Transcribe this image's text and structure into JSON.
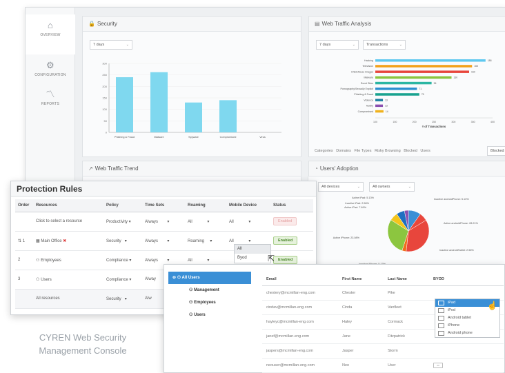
{
  "nav": [
    {
      "label": "OVERVIEW",
      "icon": "home-icon"
    },
    {
      "label": "CONFIGURATION",
      "icon": "gear-icon"
    },
    {
      "label": "REPORTS",
      "icon": "chart-icon"
    }
  ],
  "security": {
    "title": "Security",
    "range": "7 days",
    "chart_data": {
      "type": "bar",
      "categories": [
        "Phishing & Fraud",
        "Malware",
        "Spyware",
        "Compromised",
        "Virus"
      ],
      "values": [
        240,
        262,
        130,
        140,
        0
      ],
      "ylim": [
        0,
        300
      ],
      "yticks": [
        "300",
        "250",
        "200",
        "150",
        "100",
        "50",
        "0"
      ]
    }
  },
  "traffic": {
    "title": "Web Traffic Analysis",
    "range": "7 days",
    "metric": "Transactions",
    "xlabel": "# of Transactions",
    "tabs": [
      "Categories",
      "Domains",
      "File Types",
      "Risky Browsing",
      "Blocked",
      "Users"
    ],
    "blocked_btn": "Blocked",
    "chart_data": {
      "type": "bar",
      "categories": [
        "Hacking",
        "Television",
        "Child Abuse Images",
        "Malware",
        "Event Sites",
        "Pornography/Sexually Explicit",
        "Phishing & Fraud",
        "Violence",
        "Nudity",
        "Compromised"
      ],
      "values": [
        188,
        165,
        160,
        130,
        96,
        71,
        75,
        13,
        13,
        14
      ],
      "colors": [
        "#5ec8ef",
        "#f3a21c",
        "#e8463c",
        "#8cc63f",
        "#2bb6a3",
        "#2c8fd0",
        "#18a28f",
        "#1b7ea1",
        "#8a4fb0",
        "#f0b21c"
      ],
      "xticks": [
        "100",
        "150",
        "200",
        "250",
        "300",
        "350",
        "400"
      ]
    }
  },
  "trend_title": "Web Traffic Trend",
  "adoption": {
    "title": "Users' Adoption",
    "filter1": "All devices",
    "filter2": "All owners",
    "chart_data": {
      "type": "pie",
      "labels": [
        "Active iPad: 5.13%",
        "Inactive iPad: 2.56%",
        "Active iPad: 7.69%",
        "Inactive androidPhone: 5.13%",
        "Active androidPhone: 28.21%",
        "Inactive androidTablet: 2.56%",
        "Active iPhone: 23.08%",
        "Inactive iPhone: 5.13%"
      ],
      "values": [
        5.13,
        2.56,
        7.69,
        5.13,
        28.21,
        2.56,
        23.08,
        5.13
      ],
      "colors": [
        "#1f6fc1",
        "#8a4fb0",
        "#3a8fd6",
        "#e8463c",
        "#e8463c",
        "#f06d1c",
        "#8cc63f",
        "#f3c51c"
      ]
    }
  },
  "rules": {
    "title": "Protection Rules",
    "headers": [
      "Order",
      "Resources",
      "Policy",
      "Time Sets",
      "Roaming",
      "Mobile Device",
      "Status"
    ],
    "rows": [
      {
        "order": "",
        "resource": "Click to select a resource",
        "policy": "Productivity",
        "time": "Always",
        "roaming": "All",
        "mobile": "All",
        "status": "Enabled",
        "enabled": false
      },
      {
        "order": "1",
        "resource": "Main Office",
        "policy": "Security",
        "time": "Always",
        "roaming": "Roaming",
        "mobile": "All",
        "status": "Enabled",
        "enabled": true
      },
      {
        "order": "2",
        "resource": "Employees",
        "policy": "Compliance",
        "time": "Always",
        "roaming": "All",
        "mobile": "All",
        "status": "Enabled",
        "enabled": true
      },
      {
        "order": "3",
        "resource": "Users",
        "policy": "Compliance",
        "time": "Alway",
        "roaming": "",
        "mobile": "",
        "status": "",
        "enabled": true
      },
      {
        "order": "",
        "resource": "All resources",
        "policy": "Security",
        "time": "Alw",
        "roaming": "",
        "mobile": "",
        "status": "",
        "enabled": true
      }
    ],
    "mobile_options": [
      "All",
      "Byod"
    ]
  },
  "users": {
    "tree": [
      {
        "label": "All Users",
        "icon": "users-icon"
      },
      {
        "label": "Management",
        "icon": "group-icon"
      },
      {
        "label": "Employees",
        "icon": "group-icon"
      },
      {
        "label": "Users",
        "icon": "group-icon"
      }
    ],
    "headers": [
      "Email",
      "First Name",
      "Last Name",
      "BYOD"
    ],
    "rows": [
      {
        "email": "chestery@mcmillan-eng.com",
        "first": "Chester",
        "last": "Pike"
      },
      {
        "email": "cindav@mcmillan-eng.com",
        "first": "Cinda",
        "last": "Vanfleet"
      },
      {
        "email": "hayleyc@mcmillan-eng.com",
        "first": "Haley",
        "last": "Cormack"
      },
      {
        "email": "janef@mcmillan-eng.com",
        "first": "Jane",
        "last": "Fitzpatrick"
      },
      {
        "email": "jaspers@mcmillan-eng.com",
        "first": "Jasper",
        "last": "Storm"
      },
      {
        "email": "neouser@mcmillan-eng.com",
        "first": "Neo",
        "last": "User"
      }
    ],
    "byod_options": [
      "iPad",
      "iPod",
      "Android tablet",
      "iPhone",
      "Android phone"
    ]
  },
  "caption_line1": "CYREN Web Security",
  "caption_line2": "Management Console"
}
